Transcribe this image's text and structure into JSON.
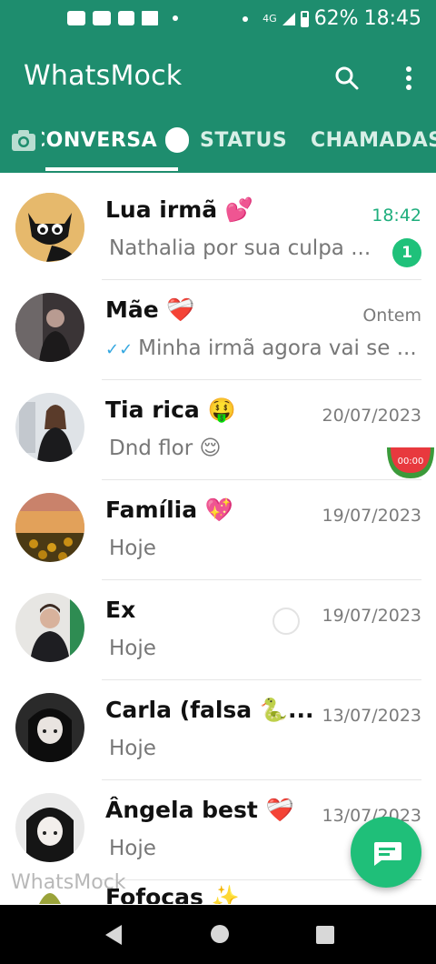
{
  "status_bar": {
    "battery": "62%",
    "time": "18:45",
    "network": "4G"
  },
  "app": {
    "title": "WhatsMock"
  },
  "tabs": [
    {
      "label": "CONVERSA"
    },
    {
      "label": "STATUS"
    },
    {
      "label": "CHAMADAS"
    }
  ],
  "chats": [
    {
      "name": "Lua irmã 💕",
      "time": "18:42",
      "message": "Nathalia por sua culpa ...",
      "unread": "1"
    },
    {
      "name": "Mãe ❤️‍🩹",
      "time": "Ontem",
      "message": "Minha irmã agora vai se ..."
    },
    {
      "name": "Tia rica 🤑",
      "time": "20/07/2023",
      "message": "Dnd flor 😌"
    },
    {
      "name": "Família 💖",
      "time": "19/07/2023",
      "message": "Hoje"
    },
    {
      "name": "Ex",
      "time": "19/07/2023",
      "message": "Hoje"
    },
    {
      "name": "Carla (falsa 🐍...",
      "time": "13/07/2023",
      "message": "Hoje"
    },
    {
      "name": "Ângela best ❤️‍🩹",
      "time": "13/07/2023",
      "message": "Hoje"
    },
    {
      "name": "Fofocas ✨",
      "time": "",
      "message": ""
    }
  ],
  "sticker_label": "00:00",
  "watermark": "WhatsMock",
  "colors": {
    "header": "#1e8d6e",
    "accent": "#1fbf79",
    "unread_time": "#1fae7d",
    "read_ticks": "#34a7e0"
  }
}
